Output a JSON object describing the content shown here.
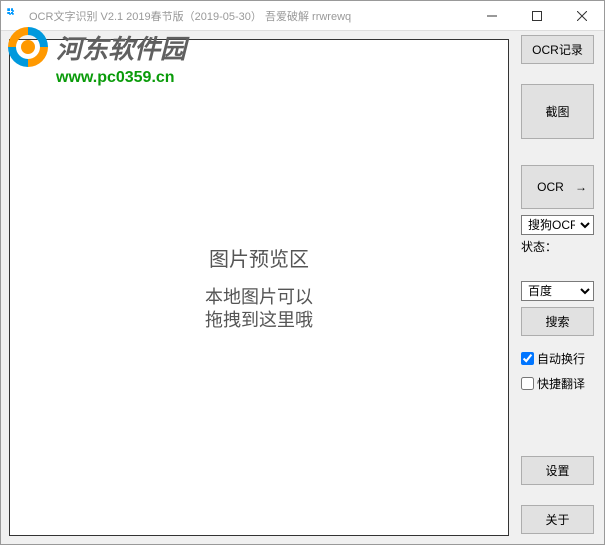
{
  "titlebar": {
    "title": "OCR文字识别 V2.1    2019春节版（2019-05-30）  吾爱破解 rrwrewq"
  },
  "watermark": {
    "text": "河东软件园",
    "url": "www.pc0359.cn"
  },
  "preview": {
    "title": "图片预览区",
    "hint_line1": "本地图片可以",
    "hint_line2": "拖拽到这里哦"
  },
  "sidebar": {
    "ocr_record": "OCR记录",
    "screenshot": "截图",
    "ocr": "OCR",
    "ocr_engine_selected": "搜狗OCR",
    "status_label": "状态：",
    "search_engine_selected": "百度",
    "search": "搜索",
    "auto_wrap": "自动换行",
    "auto_wrap_checked": true,
    "quick_translate": "快捷翻译",
    "quick_translate_checked": false,
    "settings": "设置",
    "about": "关于"
  }
}
